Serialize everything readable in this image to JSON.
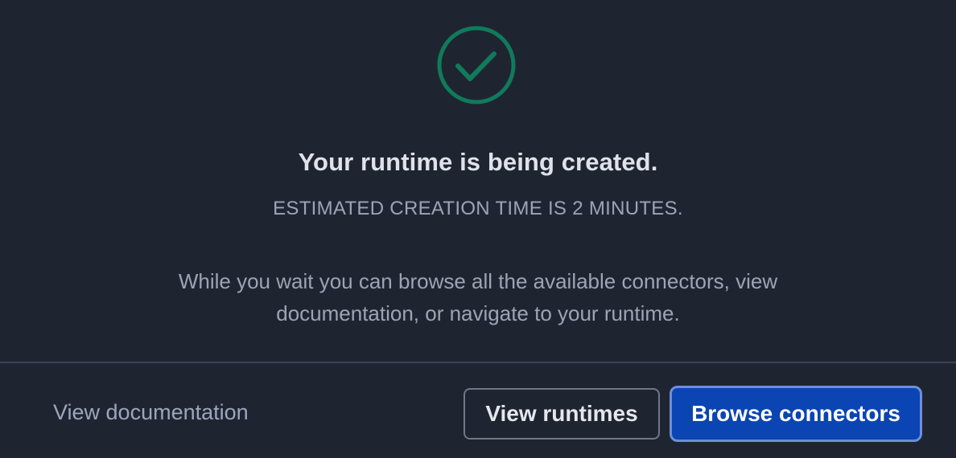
{
  "status": {
    "icon": "check-circle-icon",
    "icon_color": "#0f7b5c",
    "title": "Your runtime is being created.",
    "subtitle": "ESTIMATED CREATION TIME IS 2 MINUTES.",
    "description": "While you wait you can browse all the available connectors, view documentation, or navigate to your runtime."
  },
  "footer": {
    "documentation_link": "View documentation",
    "runtimes_button": "View runtimes",
    "connectors_button": "Browse connectors"
  },
  "colors": {
    "background": "#1f2530",
    "primary_button": "#0b44b3",
    "success": "#0f7b5c"
  }
}
